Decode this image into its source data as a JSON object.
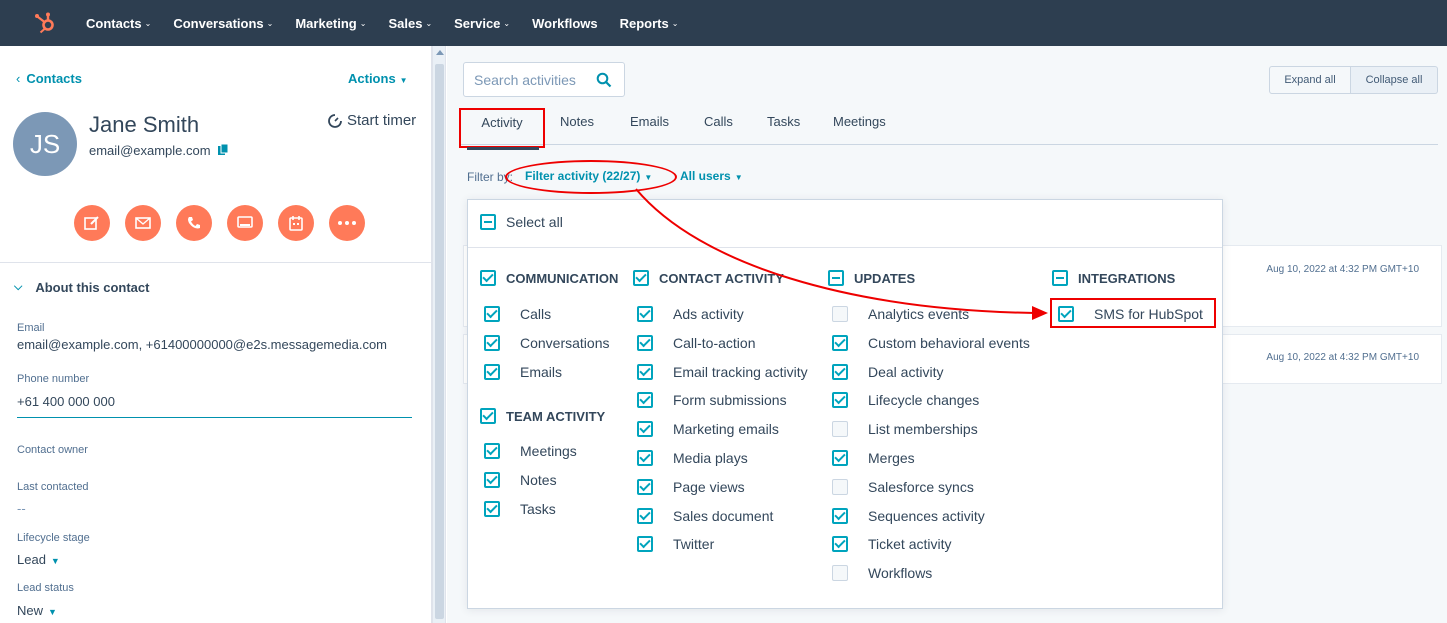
{
  "nav": {
    "items": [
      {
        "label": "Contacts",
        "has_menu": true
      },
      {
        "label": "Conversations",
        "has_menu": true
      },
      {
        "label": "Marketing",
        "has_menu": true
      },
      {
        "label": "Sales",
        "has_menu": true
      },
      {
        "label": "Service",
        "has_menu": true
      },
      {
        "label": "Workflows",
        "has_menu": false
      },
      {
        "label": "Reports",
        "has_menu": true
      }
    ],
    "brand_color": "#ff7a59",
    "bar_color": "#2d3e50"
  },
  "sidebar": {
    "back_label": "Contacts",
    "actions_label": "Actions",
    "avatar_initials": "JS",
    "name": "Jane Smith",
    "email": "email@example.com",
    "start_timer_label": "Start timer",
    "action_icons": [
      "note-icon",
      "email-icon",
      "call-icon",
      "meeting-icon",
      "task-icon",
      "more-icon"
    ],
    "about_heading": "About this contact",
    "properties": [
      {
        "label": "Email",
        "value": "email@example.com, +61400000000@e2s.messagemedia.com"
      },
      {
        "label": "Phone number",
        "value": "+61 400 000 000"
      },
      {
        "label": "Contact owner",
        "value": ""
      },
      {
        "label": "Last contacted",
        "value": "--"
      },
      {
        "label": "Lifecycle stage",
        "value": "Lead"
      },
      {
        "label": "Lead status",
        "value": "New"
      }
    ]
  },
  "main": {
    "search_placeholder": "Search activities",
    "expand_all": "Expand all",
    "collapse_all": "Collapse all",
    "tabs": [
      "Activity",
      "Notes",
      "Emails",
      "Calls",
      "Tasks",
      "Meetings"
    ],
    "filter_by": "Filter by:",
    "filter_activity": "Filter activity (22/27)",
    "all_users": "All users",
    "bg_dates": [
      "Aug 10, 2022 at 4:32 PM GMT+10",
      "Aug 10, 2022 at 4:32 PM GMT+10"
    ]
  },
  "dropdown": {
    "select_all": "Select all",
    "groups": {
      "communication": {
        "label": "COMMUNICATION",
        "items": [
          {
            "label": "Calls",
            "checked": true
          },
          {
            "label": "Conversations",
            "checked": true
          },
          {
            "label": "Emails",
            "checked": true
          }
        ]
      },
      "team_activity": {
        "label": "TEAM ACTIVITY",
        "items": [
          {
            "label": "Meetings",
            "checked": true
          },
          {
            "label": "Notes",
            "checked": true
          },
          {
            "label": "Tasks",
            "checked": true
          }
        ]
      },
      "contact_activity": {
        "label": "CONTACT ACTIVITY",
        "items": [
          {
            "label": "Ads activity",
            "checked": true
          },
          {
            "label": "Call-to-action",
            "checked": true
          },
          {
            "label": "Email tracking activity",
            "checked": true
          },
          {
            "label": "Form submissions",
            "checked": true
          },
          {
            "label": "Marketing emails",
            "checked": true
          },
          {
            "label": "Media plays",
            "checked": true
          },
          {
            "label": "Page views",
            "checked": true
          },
          {
            "label": "Sales document",
            "checked": true
          },
          {
            "label": "Twitter",
            "checked": true
          }
        ]
      },
      "updates": {
        "label": "UPDATES",
        "items": [
          {
            "label": "Analytics events",
            "checked": false
          },
          {
            "label": "Custom behavioral events",
            "checked": true
          },
          {
            "label": "Deal activity",
            "checked": true
          },
          {
            "label": "Lifecycle changes",
            "checked": true
          },
          {
            "label": "List memberships",
            "checked": false
          },
          {
            "label": "Merges",
            "checked": true
          },
          {
            "label": "Salesforce syncs",
            "checked": false
          },
          {
            "label": "Sequences activity",
            "checked": true
          },
          {
            "label": "Ticket activity",
            "checked": true
          },
          {
            "label": "Workflows",
            "checked": false
          }
        ]
      },
      "integrations": {
        "label": "INTEGRATIONS",
        "items": [
          {
            "label": "SMS for HubSpot",
            "checked": true
          }
        ]
      }
    }
  },
  "colors": {
    "accent": "#0091ae",
    "check": "#00a4bd",
    "annotation": "#ee0000",
    "action_btn": "#ff7a59"
  }
}
